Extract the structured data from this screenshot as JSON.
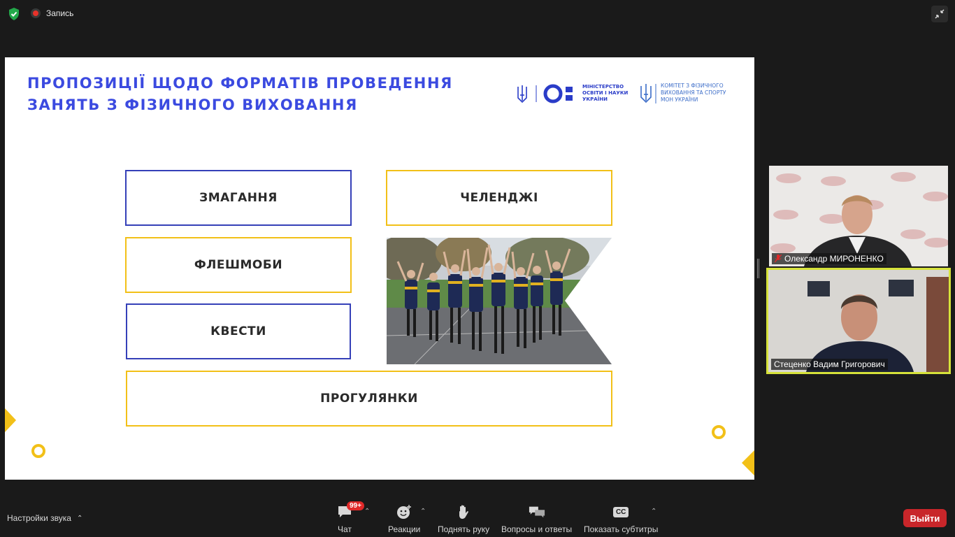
{
  "topbar": {
    "recording_label": "Запись"
  },
  "slide": {
    "title_line1": "ПРОПОЗИЦІЇ ЩОДО ФОРМАТІВ ПРОВЕДЕННЯ",
    "title_line2": "ЗАНЯТЬ З ФІЗИЧНОГО ВИХОВАННЯ",
    "ministry_line1": "МІНІСТЕРСТВО",
    "ministry_line2": "ОСВІТИ І НАУКИ",
    "ministry_line3": "УКРАЇНИ",
    "committee_line1": "КОМІТЕТ З ФІЗИЧНОГО",
    "committee_line2": "ВИХОВАННЯ ТА СПОРТУ",
    "committee_line3": "МОН УКРАЇНИ",
    "boxes": {
      "competitions": "ЗМАГАННЯ",
      "challenges": "ЧЕЛЕНДЖІ",
      "flashmobs": "ФЛЕШМОБИ",
      "quests": "КВЕСТИ",
      "walks": "ПРОГУЛЯНКИ"
    },
    "colors": {
      "title": "#3b4ae0",
      "blue_border": "#3540b8",
      "yellow_accent": "#f2c018"
    }
  },
  "participants": [
    {
      "name": "Олександр МИРОНЕНКО",
      "muted": true
    },
    {
      "name": "Стеценко Вадим Григорович",
      "muted": false,
      "active_speaker": true
    }
  ],
  "toolbar": {
    "audio_settings": "Настройки звука",
    "chat": "Чат",
    "chat_badge": "99+",
    "reactions": "Реакции",
    "raise_hand": "Поднять руку",
    "qa": "Вопросы и ответы",
    "captions": "Показать субтитры",
    "captions_icon_text": "CC",
    "leave": "Выйти"
  }
}
